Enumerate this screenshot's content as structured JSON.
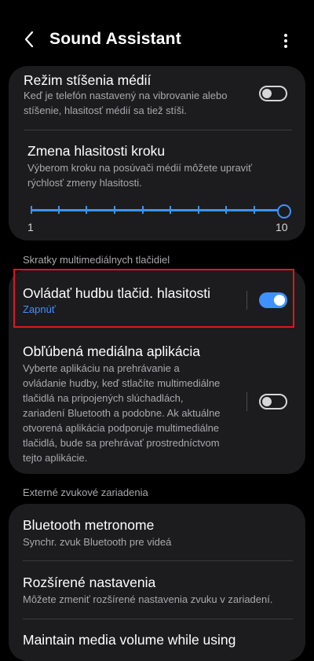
{
  "header": {
    "title": "Sound Assistant",
    "back_icon": "chevron-left-icon",
    "more_icon": "more-vertical-icon"
  },
  "mute_media": {
    "title": "Režim stíšenia médií",
    "subtitle_line1": "Keď je telefón nastavený na vibrovanie alebo",
    "subtitle_line2": "stíšenie, hlasitosť médií sa tiež stíši.",
    "enabled": false
  },
  "volume_step": {
    "title": "Zmena hlasitosti kroku",
    "subtitle_line1": "Výberom kroku na posúvači médií môžete upraviť",
    "subtitle_line2": "rýchlosť zmeny hlasitosti.",
    "min_label": "1",
    "max_label": "10",
    "value": 10,
    "accent": "#3e91ff"
  },
  "section_shortcuts": "Skratky multimediálnych tlačidiel",
  "volume_keys_music": {
    "title": "Ovládať hudbu tlačid. hlasitosti",
    "status": "Zapnúť",
    "enabled": true
  },
  "favorite_media_app": {
    "title": "Obľúbená mediálna aplikácia",
    "lines": [
      "Vyberte aplikáciu na prehrávanie a",
      "ovládanie hudby, keď stlačíte multimediálne",
      "tlačidlá na pripojených slúchadlách,",
      "zariadení Bluetooth a podobne. Ak aktuálne",
      "otvorená aplikácia podporuje multimediálne",
      "tlačidlá, bude sa prehrávať prostredníctvom",
      "tejto aplikácie."
    ],
    "enabled": false
  },
  "section_external": "Externé zvukové zariadenia",
  "bluetooth_metronome": {
    "title": "Bluetooth metronome",
    "subtitle": "Synchr. zvuk Bluetooth pre videá"
  },
  "advanced_settings": {
    "title": "Rozšírené nastavenia",
    "subtitle": "Môžete zmeniť rozšírené nastavenia zvuku v zariadení."
  },
  "maintain_volume": {
    "title": "Maintain media volume while using"
  }
}
